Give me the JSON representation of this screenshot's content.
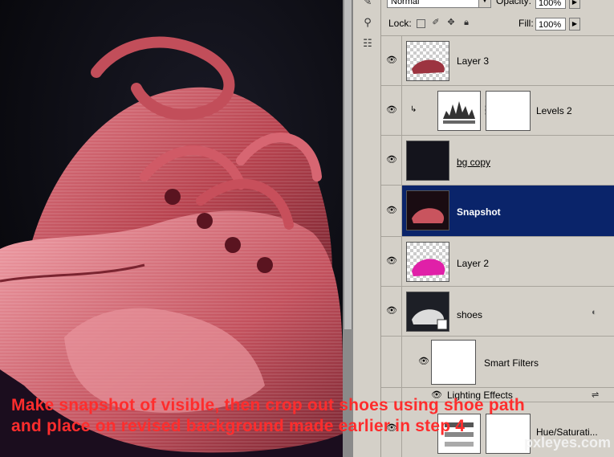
{
  "toolbar": {
    "blend_mode": "Normal",
    "opacity_label": "Opacity:",
    "opacity_value": "100%",
    "lock_label": "Lock:",
    "fill_label": "Fill:",
    "fill_value": "100%"
  },
  "layers": [
    {
      "name": "Layer 3",
      "visible": true,
      "selected": false
    },
    {
      "name": "Levels 2",
      "visible": true,
      "selected": false,
      "type": "adjustment"
    },
    {
      "name": "bg copy",
      "visible": true,
      "selected": false
    },
    {
      "name": "Snapshot",
      "visible": true,
      "selected": true
    },
    {
      "name": "Layer 2",
      "visible": true,
      "selected": false
    },
    {
      "name": "shoes",
      "visible": true,
      "selected": false,
      "type": "smart-object"
    },
    {
      "name": "Smart Filters",
      "visible": true,
      "selected": false,
      "type": "smart-filter-mask"
    },
    {
      "name": "Lighting Effects",
      "visible": true,
      "selected": false,
      "type": "filter"
    },
    {
      "name": "Hue/Saturati...",
      "visible": true,
      "selected": false,
      "type": "adjustment"
    }
  ],
  "caption": {
    "line1": "Make snapshot of visible, then crop out shoes using shoe path",
    "line2": "and place on revised background made earlier in step 4"
  },
  "watermark": "pxleyes.com",
  "colors": {
    "selection": "#0a246a",
    "caption": "#ff2d2d",
    "shoe": "#c9545e"
  }
}
